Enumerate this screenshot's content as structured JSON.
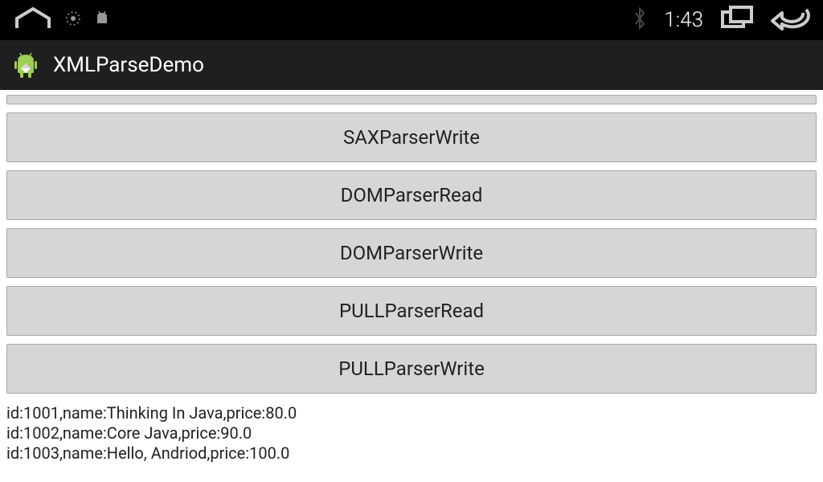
{
  "status_bar": {
    "clock": "1:43",
    "icons": {
      "home": "home-icon",
      "gps": "gps-icon",
      "android": "android-icon",
      "bluetooth": "bluetooth-icon",
      "recent": "recent-apps-icon",
      "back": "back-icon"
    }
  },
  "action_bar": {
    "title": "XMLParseDemo"
  },
  "buttons": [
    {
      "label": "SAXParserWrite",
      "name": "sax-parser-write-button"
    },
    {
      "label": "DOMParserRead",
      "name": "dom-parser-read-button"
    },
    {
      "label": "DOMParserWrite",
      "name": "dom-parser-write-button"
    },
    {
      "label": "PULLParserRead",
      "name": "pull-parser-read-button"
    },
    {
      "label": "PULLParserWrite",
      "name": "pull-parser-write-button"
    }
  ],
  "output": [
    "id:1001,name:Thinking In Java,price:80.0",
    "id:1002,name:Core Java,price:90.0",
    "id:1003,name:Hello, Andriod,price:100.0"
  ]
}
